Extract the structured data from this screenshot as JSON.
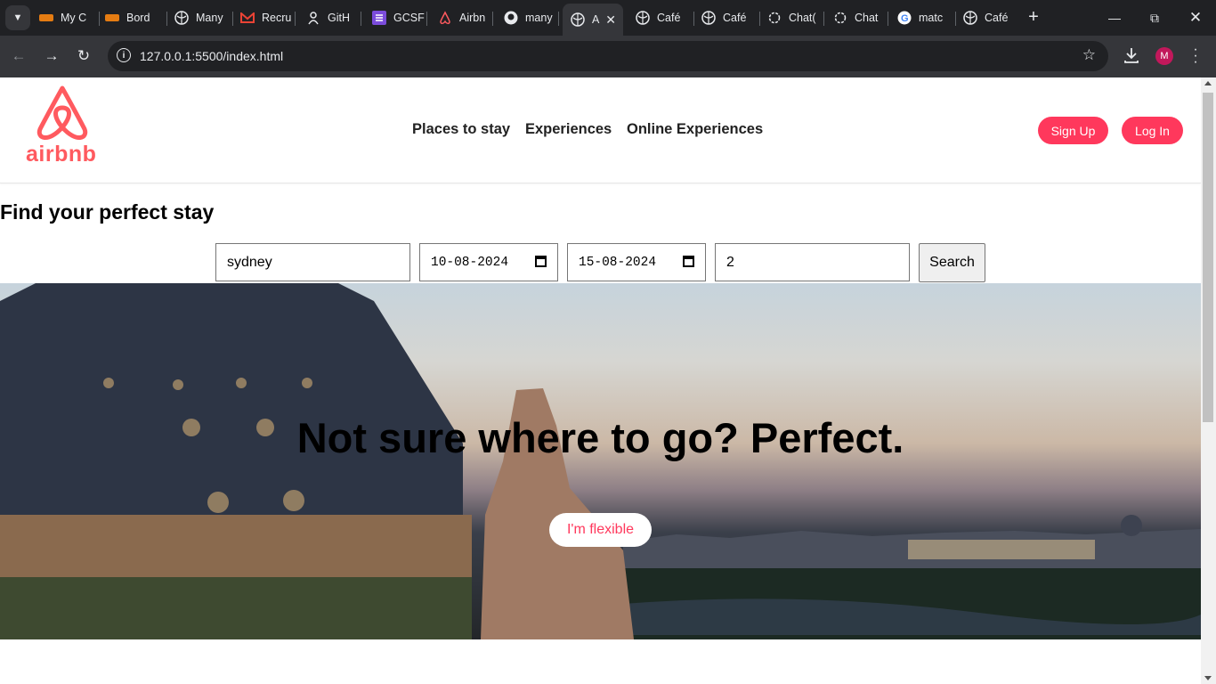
{
  "browser": {
    "tabs": [
      {
        "title": "My C",
        "icon": "orange-brand-icon"
      },
      {
        "title": "Bord",
        "icon": "orange-brand-icon"
      },
      {
        "title": "Many",
        "icon": "globe-icon"
      },
      {
        "title": "Recru",
        "icon": "gmail-icon"
      },
      {
        "title": "GitH",
        "icon": "person-icon"
      },
      {
        "title": "GCSF",
        "icon": "list-icon"
      },
      {
        "title": "Airbn",
        "icon": "airbnb-icon"
      },
      {
        "title": "many",
        "icon": "github-icon"
      },
      {
        "title": "A",
        "icon": "globe-icon",
        "active": true
      },
      {
        "title": "Café",
        "icon": "globe-icon"
      },
      {
        "title": "Café",
        "icon": "globe-icon"
      },
      {
        "title": "Chat(",
        "icon": "openai-icon"
      },
      {
        "title": "Chat",
        "icon": "openai-icon"
      },
      {
        "title": "matc",
        "icon": "google-icon"
      },
      {
        "title": "Café",
        "icon": "globe-icon"
      }
    ],
    "url": "127.0.0.1:5500/index.html",
    "profile_initial": "M"
  },
  "site": {
    "logo_text": "airbnb",
    "nav": [
      "Places to stay",
      "Experiences",
      "Online Experiences"
    ],
    "signup_label": "Sign Up",
    "login_label": "Log In",
    "brand_color": "#ff385c"
  },
  "search": {
    "title": "Find your perfect stay",
    "location_value": "sydney",
    "checkin_value": "10-08-2024",
    "checkout_value": "15-08-2024",
    "guests_value": "2",
    "button_label": "Search"
  },
  "hero": {
    "tagline": "Not sure where to go? Perfect.",
    "button_label": "I'm flexible"
  }
}
